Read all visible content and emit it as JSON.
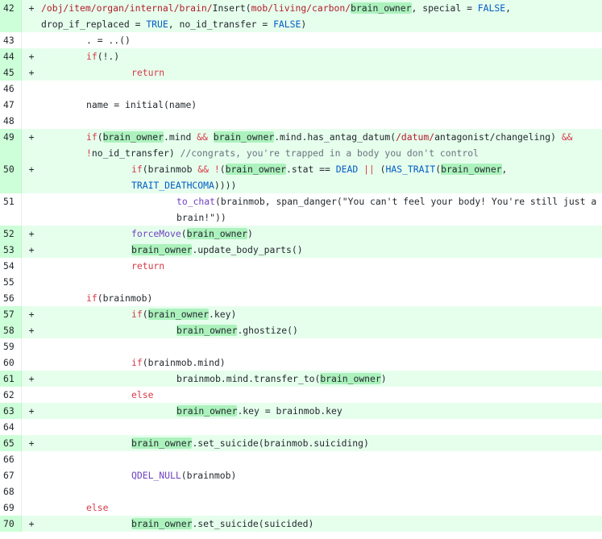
{
  "diff": {
    "lines": [
      {
        "n": "42",
        "add": true,
        "indent": 0,
        "tokens": [
          {
            "t": "/obj/item/organ/internal/brain/",
            "c": "ty"
          },
          {
            "t": "Insert",
            "c": ""
          },
          {
            "t": "(",
            "c": ""
          },
          {
            "t": "mob/living/carbon/",
            "c": "ty"
          },
          {
            "t": "brain_owner",
            "c": "hl"
          },
          {
            "t": ", special = ",
            "c": ""
          },
          {
            "t": "FALSE",
            "c": "cn"
          },
          {
            "t": ", drop_if_replaced = ",
            "c": ""
          },
          {
            "t": "TRUE",
            "c": "cn"
          },
          {
            "t": ", no_id_transfer = ",
            "c": ""
          },
          {
            "t": "FALSE",
            "c": "cn"
          },
          {
            "t": ")",
            "c": ""
          }
        ]
      },
      {
        "n": "43",
        "add": false,
        "indent": 56,
        "tokens": [
          {
            "t": ". = ..()",
            "c": ""
          }
        ]
      },
      {
        "n": "44",
        "add": true,
        "indent": 56,
        "tokens": [
          {
            "t": "if",
            "c": "kw"
          },
          {
            "t": "(!.)",
            "c": ""
          }
        ]
      },
      {
        "n": "45",
        "add": true,
        "indent": 112,
        "tokens": [
          {
            "t": "return",
            "c": "kw"
          }
        ]
      },
      {
        "n": "46",
        "add": false,
        "indent": 0,
        "tokens": []
      },
      {
        "n": "47",
        "add": false,
        "indent": 56,
        "tokens": [
          {
            "t": "name = initial(name)",
            "c": ""
          }
        ]
      },
      {
        "n": "48",
        "add": false,
        "indent": 0,
        "tokens": []
      },
      {
        "n": "49",
        "add": true,
        "indent": 56,
        "tokens": [
          {
            "t": "if",
            "c": "kw"
          },
          {
            "t": "(",
            "c": ""
          },
          {
            "t": "brain_owner",
            "c": "hl"
          },
          {
            "t": ".mind ",
            "c": ""
          },
          {
            "t": "&&",
            "c": "kw"
          },
          {
            "t": " ",
            "c": ""
          },
          {
            "t": "brain_owner",
            "c": "hl"
          },
          {
            "t": ".mind.has_antag_datum(",
            "c": ""
          },
          {
            "t": "/datum/",
            "c": "ty"
          },
          {
            "t": "antagonist/changeling) ",
            "c": ""
          },
          {
            "t": "&&",
            "c": "kw"
          },
          {
            "t": " ",
            "c": ""
          },
          {
            "t": "!",
            "c": "kw"
          },
          {
            "t": "no_id_transfer) ",
            "c": ""
          },
          {
            "t": "//congrats, you're trapped in a body you don't control",
            "c": "cm"
          }
        ]
      },
      {
        "n": "50",
        "add": true,
        "indent": 112,
        "tokens": [
          {
            "t": "if",
            "c": "kw"
          },
          {
            "t": "(brainmob ",
            "c": ""
          },
          {
            "t": "&&",
            "c": "kw"
          },
          {
            "t": " ",
            "c": ""
          },
          {
            "t": "!",
            "c": "kw"
          },
          {
            "t": "(",
            "c": ""
          },
          {
            "t": "brain_owner",
            "c": "hl"
          },
          {
            "t": ".stat == ",
            "c": ""
          },
          {
            "t": "DEAD",
            "c": "cn"
          },
          {
            "t": " ",
            "c": ""
          },
          {
            "t": "||",
            "c": "kw"
          },
          {
            "t": " (",
            "c": ""
          },
          {
            "t": "HAS_TRAIT",
            "c": "cn"
          },
          {
            "t": "(",
            "c": ""
          },
          {
            "t": "brain_owner",
            "c": "hl"
          },
          {
            "t": ", ",
            "c": ""
          },
          {
            "t": "TRAIT_DEATHCOMA",
            "c": "cn"
          },
          {
            "t": "))))",
            "c": ""
          }
        ]
      },
      {
        "n": "51",
        "add": false,
        "indent": 168,
        "tokens": [
          {
            "t": "to_chat",
            "c": "fn"
          },
          {
            "t": "(brainmob, span_danger(\"You can't feel your body! You're still just a brain!\"))",
            "c": ""
          }
        ]
      },
      {
        "n": "52",
        "add": true,
        "indent": 112,
        "tokens": [
          {
            "t": "forceMove",
            "c": "fn"
          },
          {
            "t": "(",
            "c": ""
          },
          {
            "t": "brain_owner",
            "c": "hl"
          },
          {
            "t": ")",
            "c": ""
          }
        ]
      },
      {
        "n": "53",
        "add": true,
        "indent": 112,
        "tokens": [
          {
            "t": "brain_owner",
            "c": "hl"
          },
          {
            "t": ".update_body_parts()",
            "c": ""
          }
        ]
      },
      {
        "n": "54",
        "add": false,
        "indent": 112,
        "tokens": [
          {
            "t": "return",
            "c": "kw"
          }
        ]
      },
      {
        "n": "55",
        "add": false,
        "indent": 0,
        "tokens": []
      },
      {
        "n": "56",
        "add": false,
        "indent": 56,
        "tokens": [
          {
            "t": "if",
            "c": "kw"
          },
          {
            "t": "(brainmob)",
            "c": ""
          }
        ]
      },
      {
        "n": "57",
        "add": true,
        "indent": 112,
        "tokens": [
          {
            "t": "if",
            "c": "kw"
          },
          {
            "t": "(",
            "c": ""
          },
          {
            "t": "brain_owner",
            "c": "hl"
          },
          {
            "t": ".key)",
            "c": ""
          }
        ]
      },
      {
        "n": "58",
        "add": true,
        "indent": 168,
        "tokens": [
          {
            "t": "brain_owner",
            "c": "hl"
          },
          {
            "t": ".ghostize()",
            "c": ""
          }
        ]
      },
      {
        "n": "59",
        "add": false,
        "indent": 0,
        "tokens": []
      },
      {
        "n": "60",
        "add": false,
        "indent": 112,
        "tokens": [
          {
            "t": "if",
            "c": "kw"
          },
          {
            "t": "(brainmob.mind)",
            "c": ""
          }
        ]
      },
      {
        "n": "61",
        "add": true,
        "indent": 168,
        "tokens": [
          {
            "t": "brainmob.mind.transfer_to(",
            "c": ""
          },
          {
            "t": "brain_owner",
            "c": "hl"
          },
          {
            "t": ")",
            "c": ""
          }
        ]
      },
      {
        "n": "62",
        "add": false,
        "indent": 112,
        "tokens": [
          {
            "t": "else",
            "c": "kw"
          }
        ]
      },
      {
        "n": "63",
        "add": true,
        "indent": 168,
        "tokens": [
          {
            "t": "brain_owner",
            "c": "hl"
          },
          {
            "t": ".key = brainmob.key",
            "c": ""
          }
        ]
      },
      {
        "n": "64",
        "add": false,
        "indent": 0,
        "tokens": []
      },
      {
        "n": "65",
        "add": true,
        "indent": 112,
        "tokens": [
          {
            "t": "brain_owner",
            "c": "hl"
          },
          {
            "t": ".set_suicide(brainmob.suiciding)",
            "c": ""
          }
        ]
      },
      {
        "n": "66",
        "add": false,
        "indent": 0,
        "tokens": []
      },
      {
        "n": "67",
        "add": false,
        "indent": 112,
        "tokens": [
          {
            "t": "QDEL_NULL",
            "c": "fn"
          },
          {
            "t": "(brainmob)",
            "c": ""
          }
        ]
      },
      {
        "n": "68",
        "add": false,
        "indent": 0,
        "tokens": []
      },
      {
        "n": "69",
        "add": false,
        "indent": 56,
        "tokens": [
          {
            "t": "else",
            "c": "kw"
          }
        ]
      },
      {
        "n": "70",
        "add": true,
        "indent": 112,
        "tokens": [
          {
            "t": "brain_owner",
            "c": "hl"
          },
          {
            "t": ".set_suicide(suicided)",
            "c": ""
          }
        ]
      }
    ],
    "add_marker": "+",
    "colors": {
      "added_bg": "#e6ffed",
      "added_gutter_bg": "#cdffd8",
      "word_highlight": "#acf2bd",
      "keyword": "#d73a49",
      "constant": "#005cc5",
      "path": "#b31d28",
      "comment": "#6a737d",
      "function": "#6f42c1"
    }
  }
}
